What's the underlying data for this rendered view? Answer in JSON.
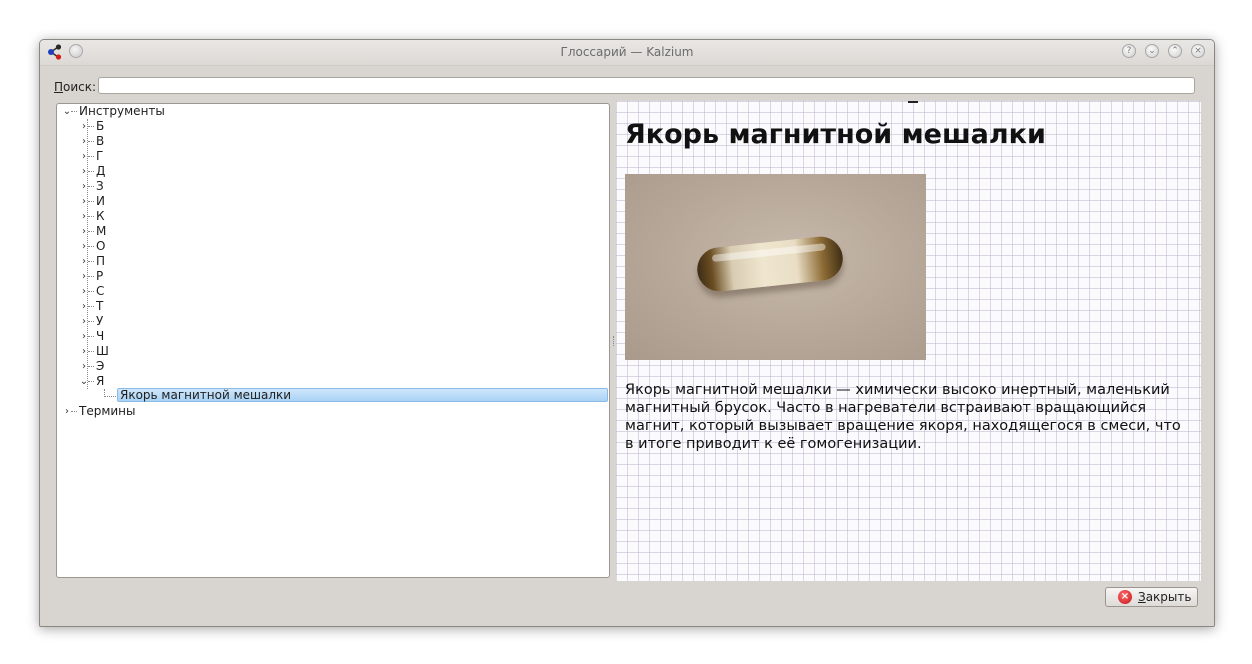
{
  "window": {
    "title": "Глоссарий — Kalzium",
    "buttons": [
      "?",
      "⌄",
      "⌃",
      "×"
    ]
  },
  "search": {
    "label_accel": "П",
    "label_rest": "оиск:",
    "value": "",
    "placeholder": ""
  },
  "tree": {
    "root1": "Инструменты",
    "letters": [
      "Б",
      "В",
      "Г",
      "Д",
      "З",
      "И",
      "К",
      "М",
      "О",
      "П",
      "Р",
      "С",
      "Т",
      "У",
      "Ч",
      "Ш",
      "Э",
      "Я"
    ],
    "selected_item": "Якорь магнитной мешалки",
    "root2": "Термины"
  },
  "viewer": {
    "title": "Якорь магнитной мешалки",
    "text": "Якорь магнитной мешалки — химически высоко инертный, маленький магнитный брусок. Часто в нагреватели встраивают вращающийся магнит, который вызывает вращение якоря, находящегося в смеси, что в итоге приводит к её гомогенизации."
  },
  "close_button": {
    "accel": "З",
    "rest": "акрыть"
  }
}
